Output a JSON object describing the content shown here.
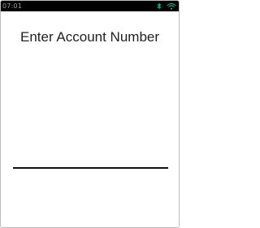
{
  "status_bar": {
    "time": "07:01",
    "icons": [
      "bluetooth-icon",
      "wifi-icon"
    ],
    "background": "#000000",
    "icon_color": "#00c8a0"
  },
  "screen": {
    "title": "Enter Account Number",
    "account_input": {
      "value": "",
      "placeholder": ""
    }
  }
}
